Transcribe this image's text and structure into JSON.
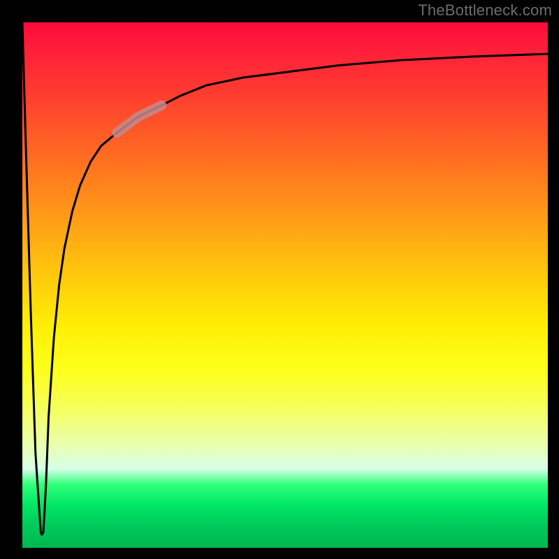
{
  "watermark": "TheBottleneck.com",
  "chart_data": {
    "type": "line",
    "title": "",
    "xlabel": "",
    "ylabel": "",
    "xlim": [
      0,
      100
    ],
    "ylim": [
      0,
      100
    ],
    "grid": false,
    "legend": false,
    "annotations": [],
    "series": [
      {
        "name": "curve",
        "x": [
          0.0,
          0.7,
          1.6,
          2.5,
          3.5,
          3.7,
          4.0,
          4.5,
          5.0,
          6.0,
          7.0,
          8.0,
          9.5,
          11.0,
          13.0,
          15.0,
          18.0,
          22.0,
          24.0,
          26.5,
          30.0,
          35.0,
          42.0,
          50.0,
          60.0,
          72.0,
          86.0,
          100.0
        ],
        "y": [
          100.0,
          75.0,
          45.0,
          18.0,
          3.0,
          2.5,
          3.0,
          12.0,
          25.0,
          40.0,
          50.0,
          57.0,
          64.0,
          69.0,
          73.5,
          76.5,
          79.0,
          82.0,
          83.0,
          84.2,
          86.0,
          88.0,
          89.5,
          90.5,
          91.8,
          92.8,
          93.5,
          94.0
        ]
      },
      {
        "name": "highlight-segment",
        "x": [
          18.0,
          22.0,
          24.0,
          26.5
        ],
        "y": [
          79.0,
          82.0,
          83.0,
          84.2
        ]
      }
    ],
    "background_gradient": {
      "direction": "top-to-bottom",
      "stops": [
        {
          "pos": 0.0,
          "color": "#ff0a3c"
        },
        {
          "pos": 0.25,
          "color": "#ff6a22"
        },
        {
          "pos": 0.5,
          "color": "#ffd208"
        },
        {
          "pos": 0.7,
          "color": "#fdff1a"
        },
        {
          "pos": 0.85,
          "color": "#d6ffe8"
        },
        {
          "pos": 1.0,
          "color": "#00b752"
        }
      ]
    }
  }
}
